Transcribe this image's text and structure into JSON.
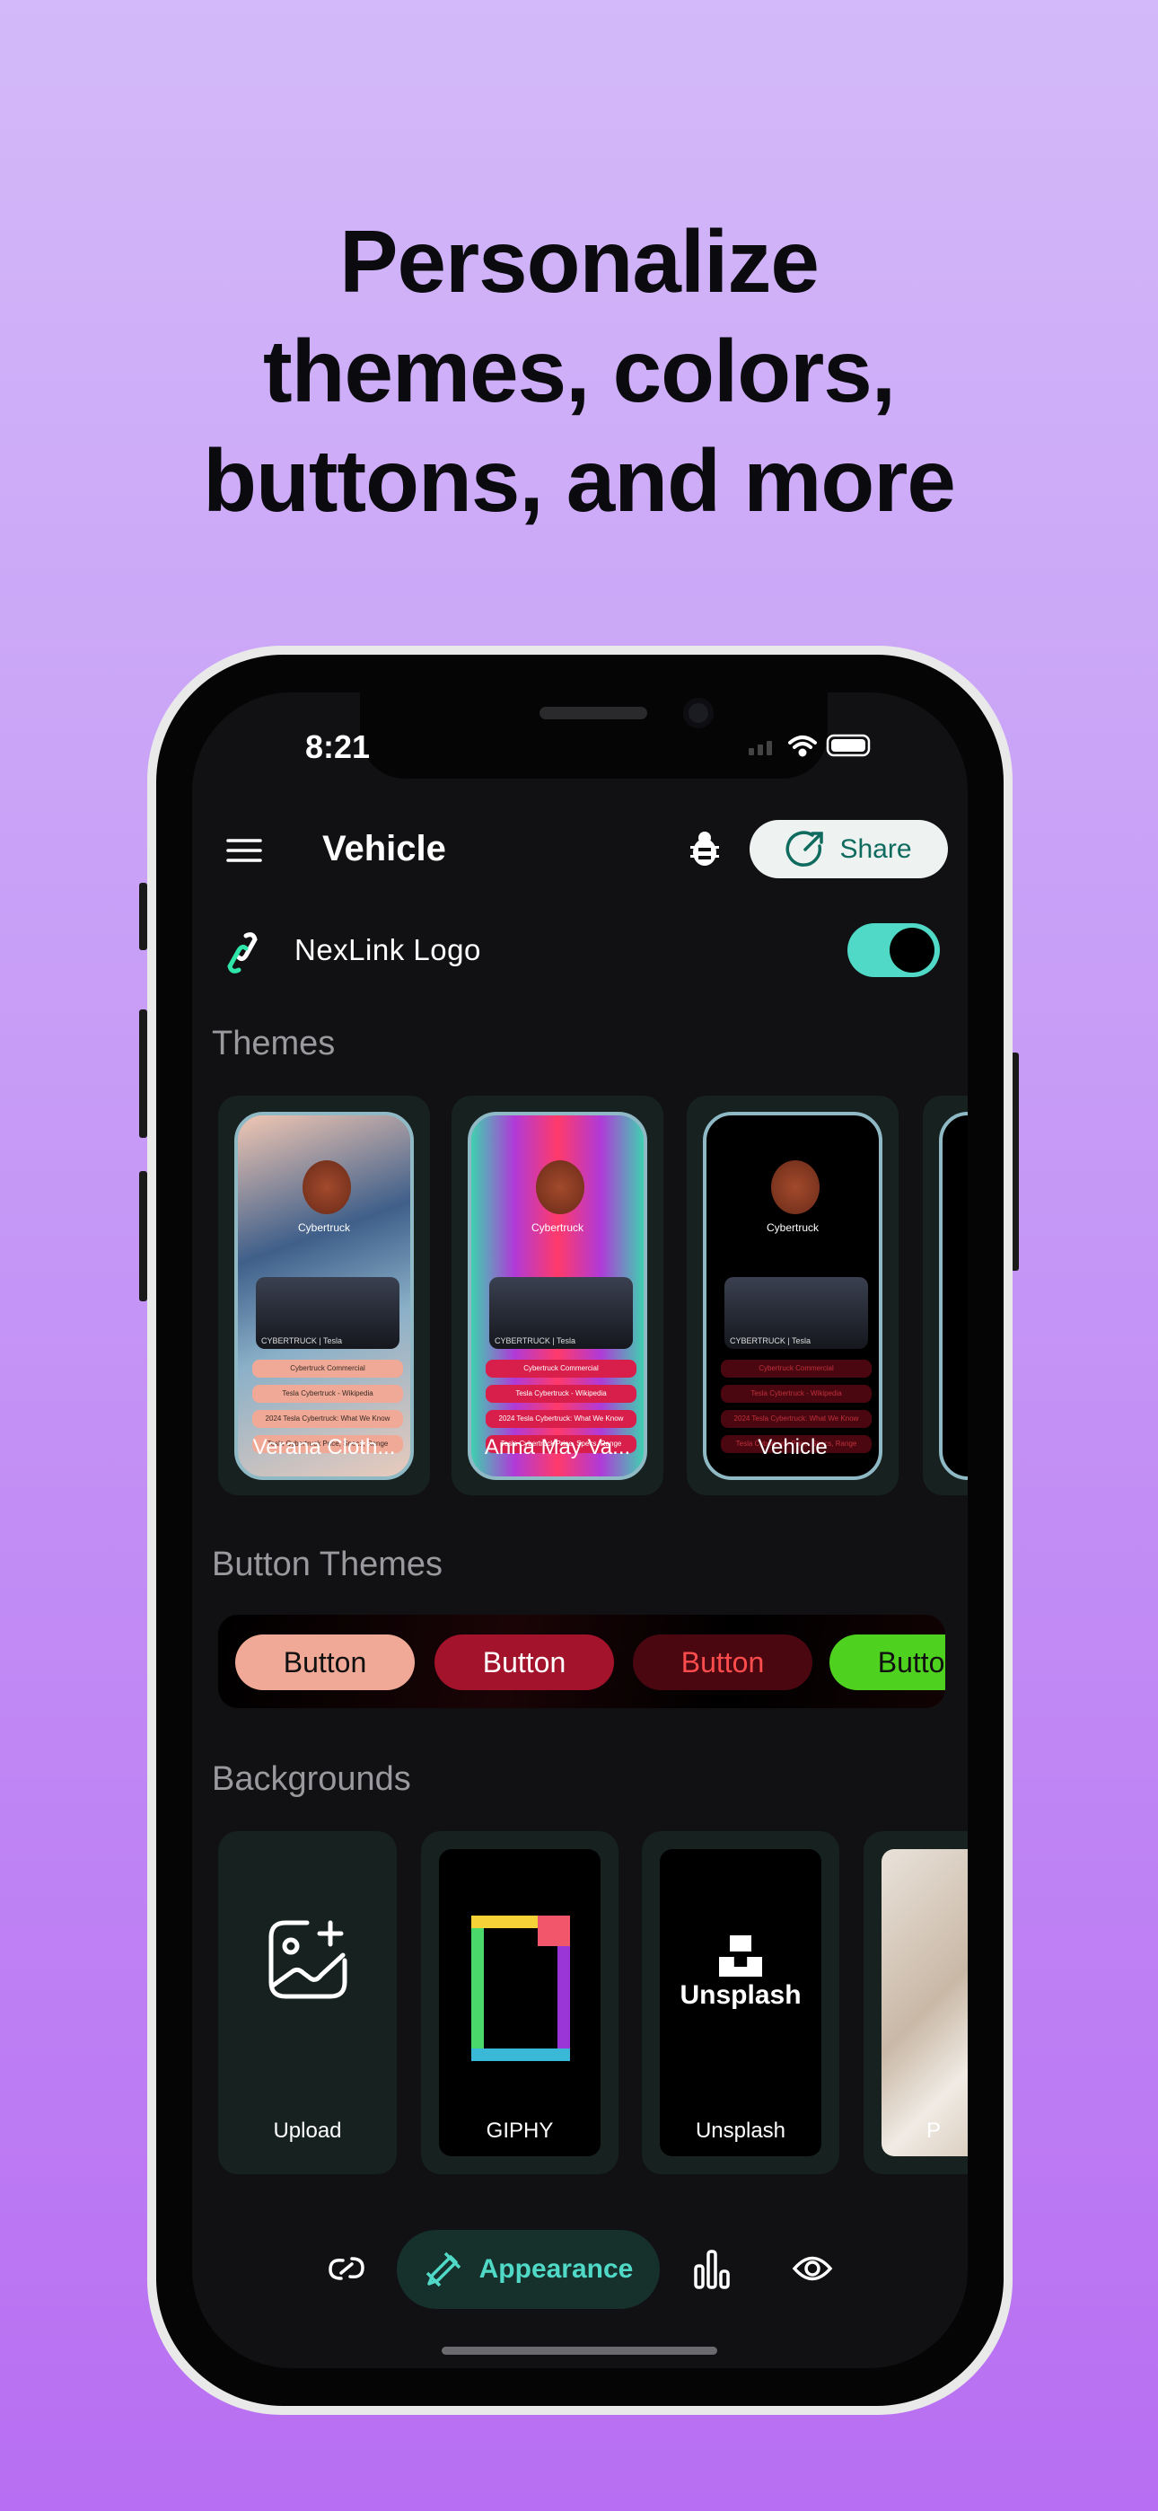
{
  "headline": {
    "lines": [
      "Personalize",
      "themes, colors,",
      "buttons, and more"
    ]
  },
  "status_bar": {
    "time": "8:21"
  },
  "header": {
    "title": "Vehicle",
    "share_label": "Share",
    "menu_icon": "hamburger-icon",
    "bug_icon": "bug-icon",
    "share_icon": "share-icon"
  },
  "logo_row": {
    "label": "NexLink Logo",
    "toggle_on": true,
    "accent": "#4fd9c6"
  },
  "themes": {
    "title": "Themes",
    "items": [
      {
        "label": "Verana Cloth...",
        "profile_name": "Cybertruck",
        "card_caption": "CYBERTRUCK | Tesla",
        "links": [
          "Cybertruck Commercial",
          "Tesla Cybertruck - Wikipedia",
          "2024 Tesla Cybertruck: What We Know",
          "Tesla Cybertruck Price, Specs, Range"
        ]
      },
      {
        "label": "Anna May Va...",
        "profile_name": "Cybertruck",
        "card_caption": "CYBERTRUCK | Tesla",
        "links": [
          "Cybertruck Commercial",
          "Tesla Cybertruck - Wikipedia",
          "2024 Tesla Cybertruck: What We Know",
          "Tesla Cybertruck Price, Specs, Range"
        ]
      },
      {
        "label": "Vehicle",
        "profile_name": "Cybertruck",
        "card_caption": "CYBERTRUCK | Tesla",
        "links": [
          "Cybertruck Commercial",
          "Tesla Cybertruck - Wikipedia",
          "2024 Tesla Cybertruck: What We Know",
          "Tesla Cybertruck Price, Specs, Range"
        ]
      }
    ]
  },
  "button_themes": {
    "title": "Button Themes",
    "items": [
      {
        "label": "Button",
        "bg": "#f0a996",
        "fg": "#111111"
      },
      {
        "label": "Button",
        "bg": "#a3132b",
        "fg": "#ffffff"
      },
      {
        "label": "Button",
        "bg": "#4a0710",
        "fg": "#ff4d4d"
      },
      {
        "label": "Button",
        "bg": "#4fd11f",
        "fg": "#111111"
      }
    ]
  },
  "backgrounds": {
    "title": "Backgrounds",
    "items": [
      {
        "label": "Upload"
      },
      {
        "label": "GIPHY"
      },
      {
        "label": "Unsplash",
        "logo_text": "Unsplash"
      },
      {
        "label": "P"
      }
    ]
  },
  "bottom_nav": {
    "items": [
      {
        "icon": "link-icon"
      },
      {
        "icon": "paintbrush-icon",
        "label": "Appearance",
        "active": true
      },
      {
        "icon": "bar-chart-icon"
      },
      {
        "icon": "eye-icon"
      }
    ]
  }
}
